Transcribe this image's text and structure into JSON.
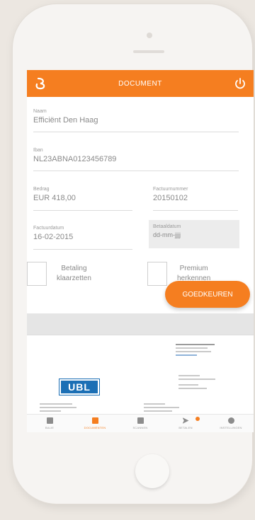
{
  "appbar": {
    "title": "DOCUMENT"
  },
  "form": {
    "naam": {
      "label": "Naam",
      "value": "Efficiënt Den Haag"
    },
    "iban": {
      "label": "Iban",
      "value": "NL23ABNA0123456789"
    },
    "bedrag": {
      "label": "Bedrag",
      "value": "EUR 418,00"
    },
    "factuurnummer": {
      "label": "Factuurnummer",
      "value": "20150102"
    },
    "factuurdatum": {
      "label": "Factuurdatum",
      "value": "16-02-2015"
    },
    "betaaldatum": {
      "label": "Betaaldatum",
      "value": "dd-mm-jjjj"
    }
  },
  "checkboxes": {
    "betaling": {
      "label_line1": "Betaling",
      "label_line2": "klaarzetten"
    },
    "premium": {
      "label_line1": "Premium",
      "label_line2": "herkennen"
    }
  },
  "approve_button": "GOEDKEUREN",
  "preview": {
    "logo_text": "UBL"
  },
  "bottom_nav": [
    {
      "label": "BALIE",
      "icon": "home-icon"
    },
    {
      "label": "DOCUMENTEN",
      "icon": "document-icon",
      "active": true
    },
    {
      "label": "SCANNEN",
      "icon": "camera-icon"
    },
    {
      "label": "BETALEN",
      "icon": "send-icon"
    },
    {
      "label": "INSTELLINGEN",
      "icon": "gear-icon"
    }
  ],
  "colors": {
    "accent": "#f57e20",
    "ubl_blue": "#1b6fb5"
  }
}
